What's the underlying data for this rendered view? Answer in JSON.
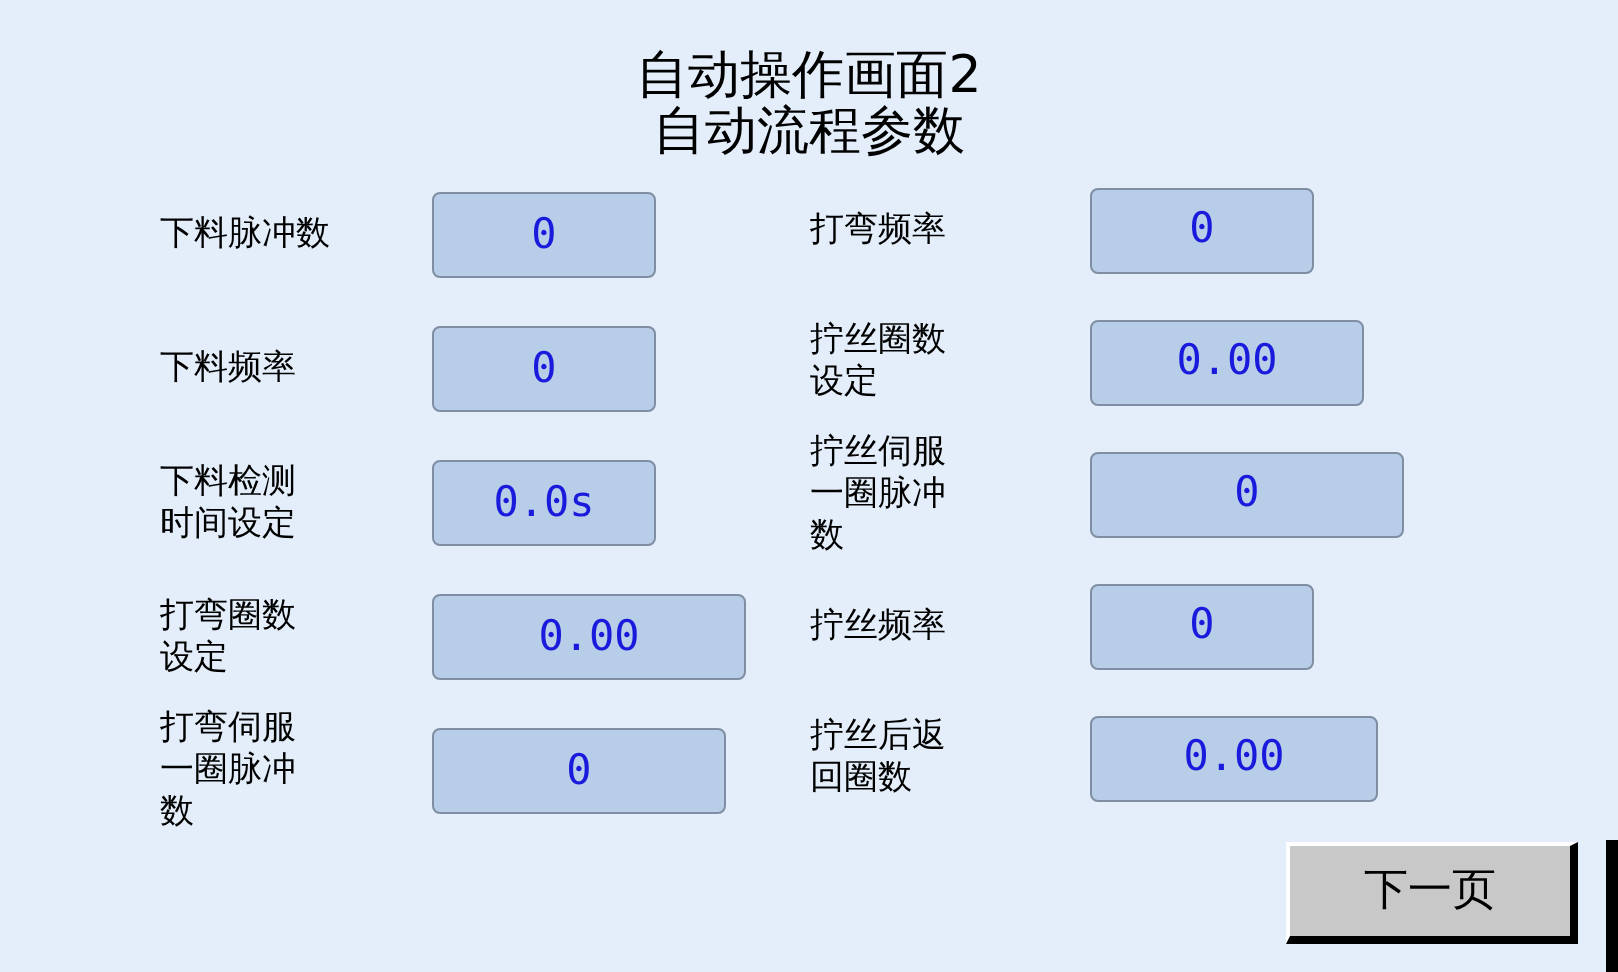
{
  "title": [
    "自动操作画面2",
    "自动流程参数"
  ],
  "left_params": [
    {
      "label": "下料脉冲数",
      "value": "0"
    },
    {
      "label": "下料频率",
      "value": "0"
    },
    {
      "label": "下料检测时间设定",
      "value": "0.0s"
    },
    {
      "label": "打弯圈数设定",
      "value": "0.00"
    },
    {
      "label": "打弯伺服一圈脉冲数",
      "value": "0"
    }
  ],
  "right_params": [
    {
      "label": "打弯频率",
      "value": "0"
    },
    {
      "label": "拧丝圈数设定",
      "value": "0.00"
    },
    {
      "label": "拧丝伺服一圈脉冲数",
      "value": "0"
    },
    {
      "label": "拧丝频率",
      "value": "0"
    },
    {
      "label": "拧丝后返回圈数",
      "value": "0.00"
    }
  ],
  "next_button": "下一页"
}
